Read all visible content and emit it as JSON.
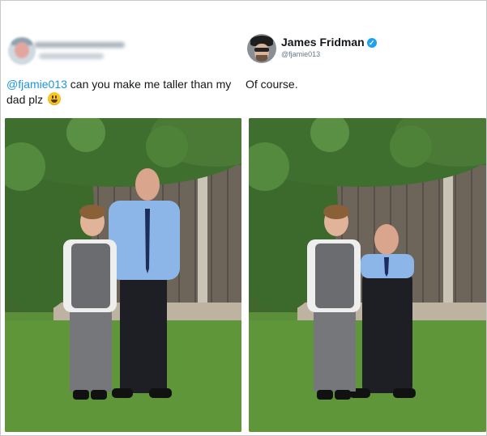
{
  "original_tweet": {
    "user_name": "",
    "user_handle": "",
    "mention": "@fjamie013",
    "text": " can you make me taller than my dad plz",
    "emoji": "grinning-face-emoji"
  },
  "reply_tweet": {
    "user_name": "James Fridman",
    "verified": true,
    "user_handle": "@fjamie013",
    "text": "Of course."
  },
  "colors": {
    "link": "#1b95e0",
    "verified": "#1da1f2",
    "text": "#14171a",
    "muted": "#657786",
    "hedge": "#3f6a2e",
    "lawn": "#5c8f3a",
    "fence": "#6e655a"
  },
  "photos": [
    {
      "name": "original-photo",
      "edit": "none"
    },
    {
      "name": "edited-photo",
      "edit": "dad-shrunk"
    }
  ]
}
